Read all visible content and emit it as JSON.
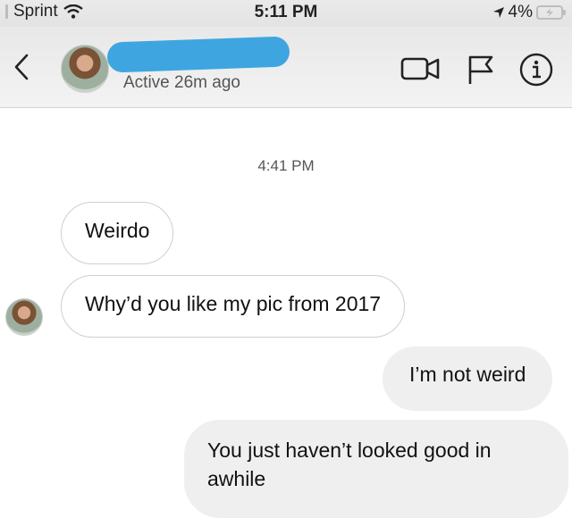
{
  "status_bar": {
    "carrier": "Sprint",
    "time": "5:11 PM",
    "battery": "4%"
  },
  "header": {
    "active_status": "Active 26m ago"
  },
  "thread": {
    "timestamp": "4:41 PM",
    "messages": [
      {
        "direction": "incoming",
        "text": "Weirdo"
      },
      {
        "direction": "incoming",
        "text": "Why’d you like my pic from 2017"
      },
      {
        "direction": "outgoing",
        "text": "I’m not weird"
      },
      {
        "direction": "outgoing",
        "text": "You just haven’t looked good in awhile"
      }
    ]
  },
  "icons": [
    "back-chevron-icon",
    "video-call-icon",
    "flag-icon",
    "info-icon"
  ],
  "colors": {
    "redaction": "#3fa5e0",
    "outgoing_bubble": "#efefef"
  }
}
